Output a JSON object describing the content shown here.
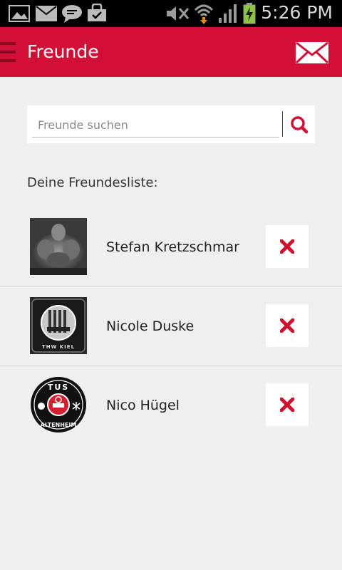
{
  "status_bar": {
    "time": "5:26 PM",
    "notification_icons": [
      "gallery-icon",
      "email-icon",
      "chat-icon",
      "shopping-bag-icon"
    ],
    "system_icons": [
      "mute-icon",
      "wifi-icon",
      "signal-icon",
      "battery-charging-icon"
    ]
  },
  "app_bar": {
    "title": "Freunde",
    "menu_icon": "menu-icon",
    "action_icon": "mail-icon"
  },
  "search": {
    "placeholder": "Freunde suchen",
    "value": "",
    "button_icon": "search-icon"
  },
  "friends_list": {
    "heading": "Deine Freundesliste:",
    "items": [
      {
        "name": "Stefan Kretzschmar",
        "avatar": "photo-avatar",
        "action_icon": "remove-icon"
      },
      {
        "name": "Nicole Duske",
        "avatar": "thw-kiel-logo",
        "avatar_text": "THW KIEL",
        "action_icon": "remove-icon"
      },
      {
        "name": "Nico Hügel",
        "avatar": "tus-altenheim-logo",
        "avatar_text_top": "TUS",
        "avatar_text_bottom": "ALTENHEIM",
        "action_icon": "remove-icon"
      }
    ]
  },
  "colors": {
    "brand_red": "#d20f36",
    "background": "#efefef",
    "remove_red": "#d0102f"
  }
}
